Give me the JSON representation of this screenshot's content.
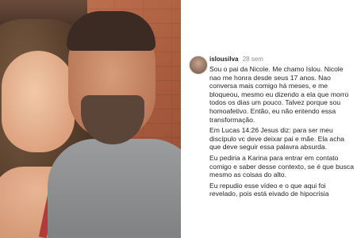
{
  "comment": {
    "username": "islousilva",
    "time": "28 sem",
    "paragraphs": [
      "Sou o pai da Nicole. Me chamo Islou. Nicole nao me honra desde seus 17 anos. Nao conversa mais  comigo há meses, e me bloqueou, mesmo eu dizendo a ela que morro todos os dias um pouco. Talvez porque sou homoafetivo. Então, eu não entendo essa transformação.",
      "Em Lucas 14:26 Jesus diz:  para ser meu discípulo vc deve deixar pai e mãe. Ela acha que deve seguir essa palavra absurda.",
      "Eu pediria a Karina para entrar em contato comigo e saber desse contexto, se é que busca mesmo as coisas do alto.",
      "Eu repudio esse vídeo e o que aqui foi revelado, pois está eivado de hipocrisia"
    ]
  }
}
